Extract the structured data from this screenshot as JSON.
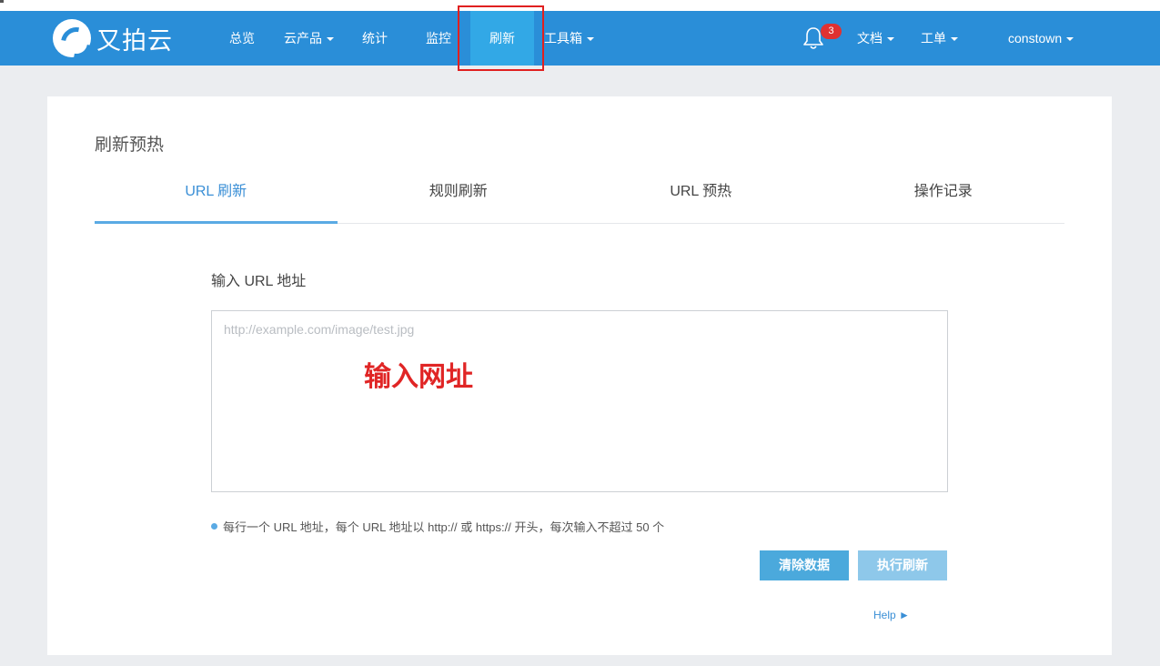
{
  "brand": {
    "name": "又拍云"
  },
  "nav": {
    "items": [
      {
        "label": "总览",
        "dropdown": false
      },
      {
        "label": "云产品",
        "dropdown": true
      },
      {
        "label": "统计",
        "dropdown": false
      },
      {
        "label": "监控",
        "dropdown": false
      },
      {
        "label": "刷新",
        "dropdown": false,
        "active": true
      },
      {
        "label": "工具箱",
        "dropdown": true
      }
    ],
    "notifications": {
      "icon": "bell-icon",
      "count": "3"
    },
    "docs": "文档",
    "tickets": "工单",
    "user": "constown"
  },
  "page": {
    "title": "刷新预热",
    "tabs": [
      {
        "label": "URL 刷新",
        "active": true
      },
      {
        "label": "规则刷新",
        "active": false
      },
      {
        "label": "URL 预热",
        "active": false
      },
      {
        "label": "操作记录",
        "active": false
      }
    ]
  },
  "form": {
    "label": "输入 URL 地址",
    "placeholder": "http://example.com/image/test.jpg",
    "value": "",
    "annotation": "输入网址",
    "hint": "每行一个 URL 地址，每个 URL 地址以 http:// 或 https:// 开头，每次输入不超过 50 个",
    "clear_button": "清除数据",
    "execute_button": "执行刷新",
    "help_link": "Help ►"
  },
  "colors": {
    "navbar": "#2a8ed8",
    "nav_active": "#32a8e6",
    "accent": "#3a8fd6",
    "annotation_red": "#e02525",
    "badge": "#e03131"
  }
}
